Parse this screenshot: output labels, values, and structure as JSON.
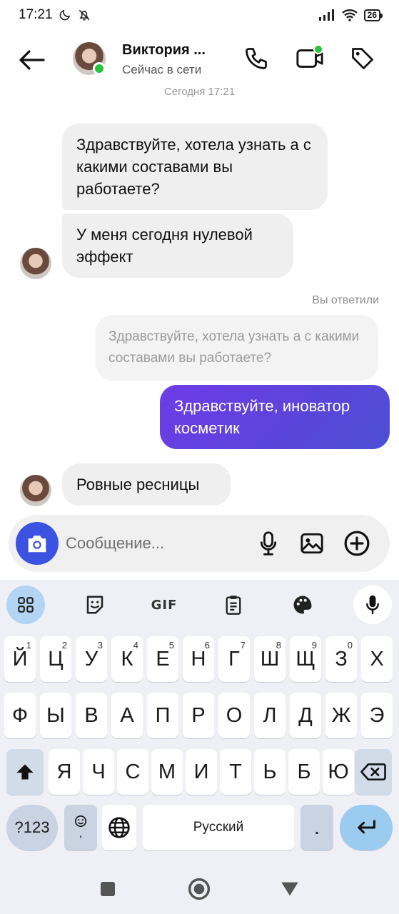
{
  "status_bar": {
    "time": "17:21",
    "battery": "26"
  },
  "header": {
    "name": "Виктория ...",
    "status": "Сейчас в сети"
  },
  "chat": {
    "timestamp": "Сегодня 17:21",
    "messages": [
      {
        "text": "Здравствуйте, хотела узнать а с какими составами вы работаете?"
      },
      {
        "text": "У меня сегодня нулевой эффект"
      },
      {
        "text": "Ровные ресницы"
      }
    ],
    "reply": {
      "label": "Вы ответили",
      "quoted_text": "Здравствуйте, хотела узнать а с какими составами вы работаете?",
      "text": "Здравствуйте, иноватор косметик"
    }
  },
  "composer": {
    "placeholder": "Сообщение..."
  },
  "keyboard": {
    "toolbar": {
      "gif_label": "GIF"
    },
    "row1": [
      {
        "label": "Й",
        "hint": "1"
      },
      {
        "label": "Ц",
        "hint": "2"
      },
      {
        "label": "У",
        "hint": "3"
      },
      {
        "label": "К",
        "hint": "4"
      },
      {
        "label": "Е",
        "hint": "5"
      },
      {
        "label": "Н",
        "hint": "6"
      },
      {
        "label": "Г",
        "hint": "7"
      },
      {
        "label": "Ш",
        "hint": "8"
      },
      {
        "label": "Щ",
        "hint": "9"
      },
      {
        "label": "З",
        "hint": "0"
      },
      {
        "label": "Х",
        "hint": ""
      }
    ],
    "row2": [
      "Ф",
      "Ы",
      "В",
      "А",
      "П",
      "Р",
      "О",
      "Л",
      "Д",
      "Ж",
      "Э"
    ],
    "row3": [
      "Я",
      "Ч",
      "С",
      "М",
      "И",
      "Т",
      "Ь",
      "Б",
      "Ю"
    ],
    "symbols_label": "?123",
    "comma_label": ",",
    "space_label": "Русский",
    "period_label": "."
  },
  "colors": {
    "accent": "#5a45d9",
    "online": "#2ac13b",
    "camera": "#3b53e0"
  }
}
